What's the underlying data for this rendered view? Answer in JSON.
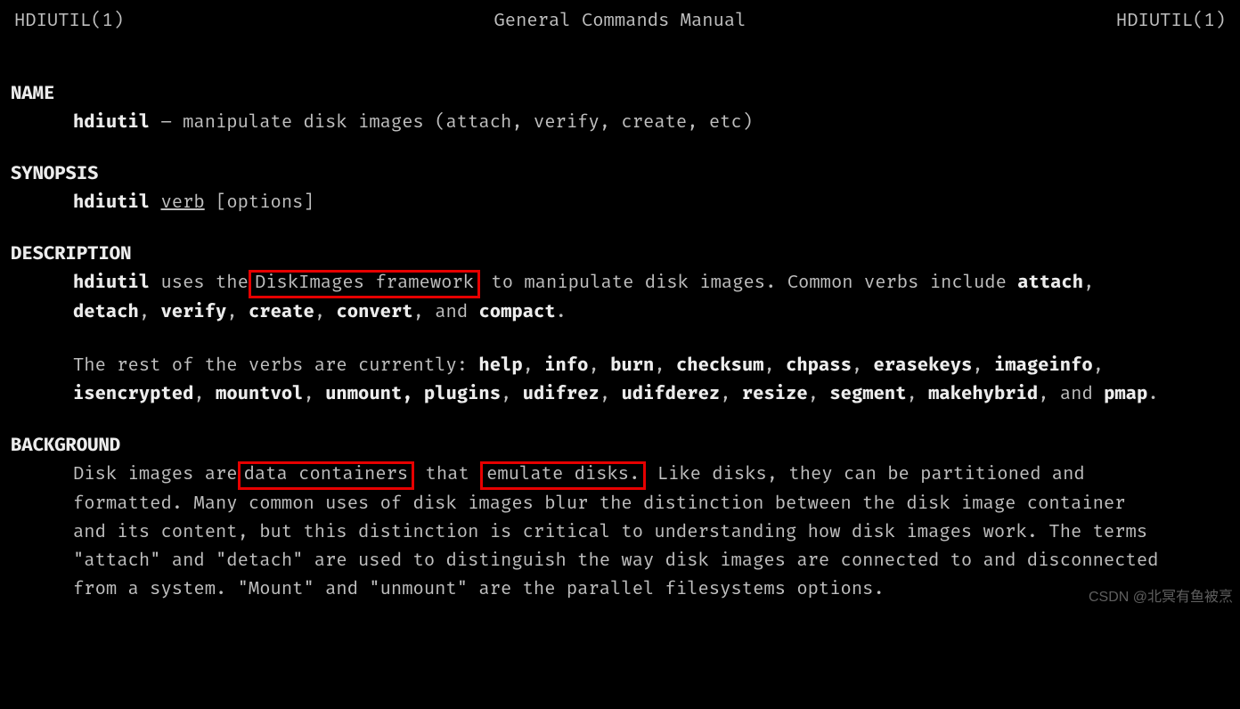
{
  "header": {
    "left": "HDIUTIL(1)",
    "center": "General Commands Manual",
    "right": "HDIUTIL(1)"
  },
  "sections": {
    "name_head": "NAME",
    "name": {
      "cmd": "hdiutil",
      "desc": " – manipulate disk images (attach, verify, create, etc)"
    },
    "synopsis_head": "SYNOPSIS",
    "synopsis": {
      "cmd": "hdiutil",
      "verb": "verb",
      "options": " [options]"
    },
    "description_head": "DESCRIPTION",
    "desc1": {
      "cmd": "hdiutil",
      "t1": " uses the",
      "boxed": " DiskImages framework",
      "t2": " to manipulate disk images.  Common verbs include ",
      "b1": "attach",
      "b2": "detach",
      "b3": "verify",
      "b4": "create",
      "b5": "convert",
      "and": ", and ",
      "b6": "compact",
      "period": "."
    },
    "desc2": {
      "t0": "The rest of the verbs are currently: ",
      "b1": "help",
      "b2": "info",
      "b3": "burn",
      "b4": "checksum",
      "b5": "chpass",
      "b6": "erasekeys",
      "b7": "imageinfo",
      "b8": "isencrypted",
      "b9": "mountvol",
      "b10": "unmount,",
      "b11": "plugins",
      "b12": "udifrez",
      "b13": "udifderez",
      "b14": "resize",
      "b15": "segment",
      "b16": "makehybrid",
      "and": ", and ",
      "b17": "pmap",
      "period": "."
    },
    "background_head": "BACKGROUND",
    "bg": {
      "t1": "Disk images are",
      "boxed1": " data containers",
      "t2": " that ",
      "boxed2": "emulate disks.",
      "t3": "  Like disks, they can be partitioned and formatted.  Many common uses of disk images blur the distinction between the disk image container and its content, but this distinction is critical to understanding how disk images work.  The terms \"attach\" and \"detach\" are used to distinguish the way disk images are connected to and disconnected from a system.  \"Mount\" and \"unmount\" are the parallel filesystems options."
    }
  },
  "watermark": "CSDN @北冥有鱼被烹"
}
